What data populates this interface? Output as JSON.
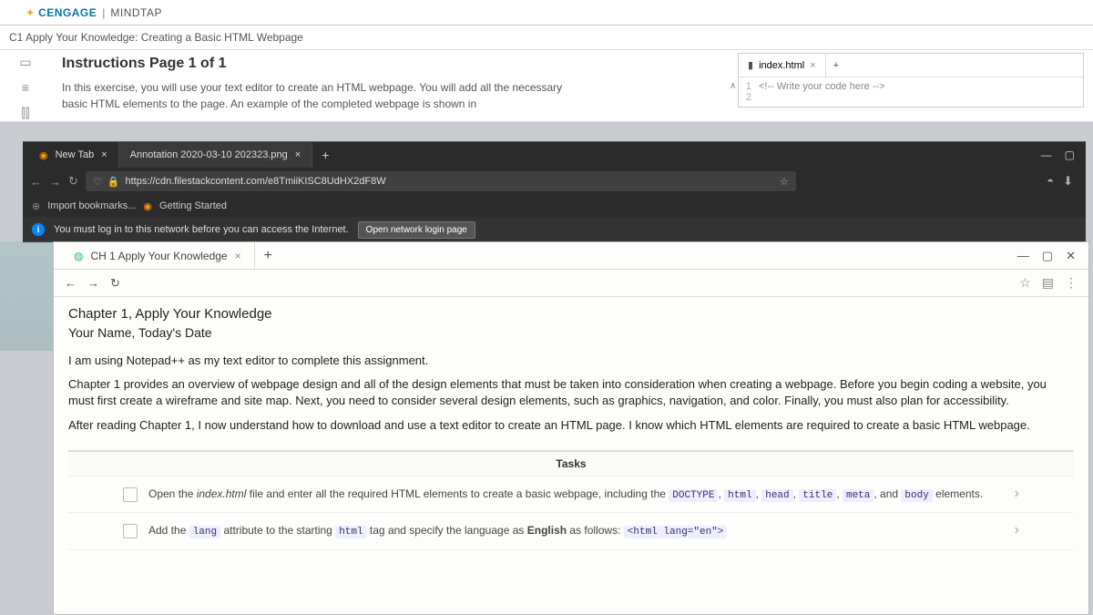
{
  "header": {
    "brand1": "CENGAGE",
    "brand2": "MINDTAP"
  },
  "assignment": "C1 Apply Your Knowledge: Creating a Basic HTML Webpage",
  "instructions": {
    "heading": "Instructions Page 1 of 1",
    "body": "In this exercise, you will use your text editor to create an HTML webpage. You will add all the necessary basic HTML elements to the page. An example of the completed webpage is shown in"
  },
  "editor": {
    "tab_name": "index.html",
    "line1": "1",
    "line2": "2",
    "code": "<!-- Write your code here -->"
  },
  "darkBrowser": {
    "tab1": "New Tab",
    "tab2": "Annotation 2020-03-10 202323.png",
    "url": "https://cdn.filestackcontent.com/e8TmiiKISC8UdHX2dF8W",
    "bookmark_import": "Import bookmarks...",
    "bookmark_start": "Getting Started",
    "notice": "You must log in to this network before you can access the Internet.",
    "login_btn": "Open network login page"
  },
  "innerBrowser": {
    "tab": "CH 1 Apply Your Knowledge"
  },
  "page": {
    "h1": "Chapter 1, Apply Your Knowledge",
    "h2": "Your Name, Today's Date",
    "p1": "I am using Notepad++ as my text editor to complete this assignment.",
    "p2": "Chapter 1 provides an overview of webpage design and all of the design elements that must be taken into consideration when creating a webpage. Before you begin coding a website, you must first create a wireframe and site map. Next, you need to consider several design elements, such as graphics, navigation, and color. Finally, you must also plan for accessibility.",
    "p3": "After reading Chapter 1, I now understand how to download and use a text editor to create an HTML page. I know which HTML elements are required to create a basic HTML webpage."
  },
  "tasks": {
    "heading": "Tasks",
    "t1_a": "Open the ",
    "t1_file": "index.html",
    "t1_b": " file and enter all the required HTML elements to create a basic webpage, including the ",
    "t1_c1": "DOCTYPE",
    "t1_c2": "html",
    "t1_c3": "head",
    "t1_c4": "title",
    "t1_c5": "meta",
    "t1_d": ", and ",
    "t1_c6": "body",
    "t1_e": " elements.",
    "t2_a": "Add the ",
    "t2_c1": "lang",
    "t2_b": " attribute to the starting ",
    "t2_c2": "html",
    "t2_c": " tag and specify the language as ",
    "t2_bold": "English",
    "t2_d": " as follows: ",
    "t2_code": "<html lang=\"en\">"
  }
}
